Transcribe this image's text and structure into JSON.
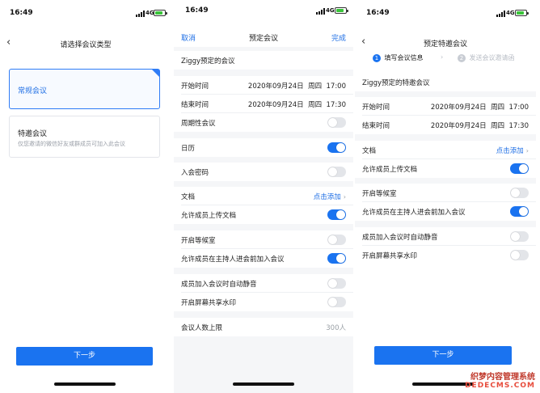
{
  "status_bar": {
    "time": "16:49",
    "network": "4G"
  },
  "screen1": {
    "title": "请选择会议类型",
    "regular_card": {
      "name": "常规会议"
    },
    "special_card": {
      "name": "特邀会议",
      "desc": "仅您邀请的微信好友或群成员可加入此会议"
    },
    "next_button": "下一步"
  },
  "screen2": {
    "cancel": "取消",
    "title": "预定会议",
    "done": "完成",
    "meeting_name": "Ziggy预定的会议",
    "start": {
      "label": "开始时间",
      "date": "2020年09月24日",
      "weekday": "周四",
      "time": "17:00"
    },
    "end": {
      "label": "结束时间",
      "date": "2020年09月24日",
      "weekday": "周四",
      "time": "17:30"
    },
    "periodic": {
      "label": "周期性会议",
      "on": false
    },
    "calendar": {
      "label": "日历",
      "on": true
    },
    "password": {
      "label": "入会密码",
      "on": false
    },
    "docs": {
      "label": "文档",
      "action": "点击添加"
    },
    "allow_upload": {
      "label": "允许成员上传文档",
      "on": true
    },
    "waiting_room": {
      "label": "开启等候室",
      "on": false
    },
    "join_before_host": {
      "label": "允许成员在主持人进会前加入会议",
      "on": true
    },
    "auto_mute": {
      "label": "成员加入会议时自动静音",
      "on": false
    },
    "watermark": {
      "label": "开启屏幕共享水印",
      "on": false
    },
    "limit": {
      "label": "会议人数上限",
      "value": "300人"
    }
  },
  "screen3": {
    "title": "预定特邀会议",
    "step1": {
      "num": "1",
      "label": "填写会议信息"
    },
    "step2": {
      "num": "2",
      "label": "发送会议邀请函"
    },
    "meeting_name": "Ziggy预定的特邀会议",
    "start": {
      "label": "开始时间",
      "date": "2020年09月24日",
      "weekday": "周四",
      "time": "17:00"
    },
    "end": {
      "label": "结束时间",
      "date": "2020年09月24日",
      "weekday": "周四",
      "time": "17:30"
    },
    "docs": {
      "label": "文档",
      "action": "点击添加"
    },
    "allow_upload": {
      "label": "允许成员上传文档",
      "on": true
    },
    "waiting_room": {
      "label": "开启等候室",
      "on": false
    },
    "join_before_host": {
      "label": "允许成员在主持人进会前加入会议",
      "on": true
    },
    "auto_mute": {
      "label": "成员加入会议时自动静音",
      "on": false
    },
    "watermark": {
      "label": "开启屏幕共享水印",
      "on": false
    },
    "next_button": "下一步"
  },
  "site_watermark": {
    "cn": "织梦内容管理系统",
    "en": "DEDECMS.COM"
  },
  "colors": {
    "accent": "#1a73f0",
    "toggle_off": "#e3e5e9",
    "battery": "#3ac43a"
  }
}
